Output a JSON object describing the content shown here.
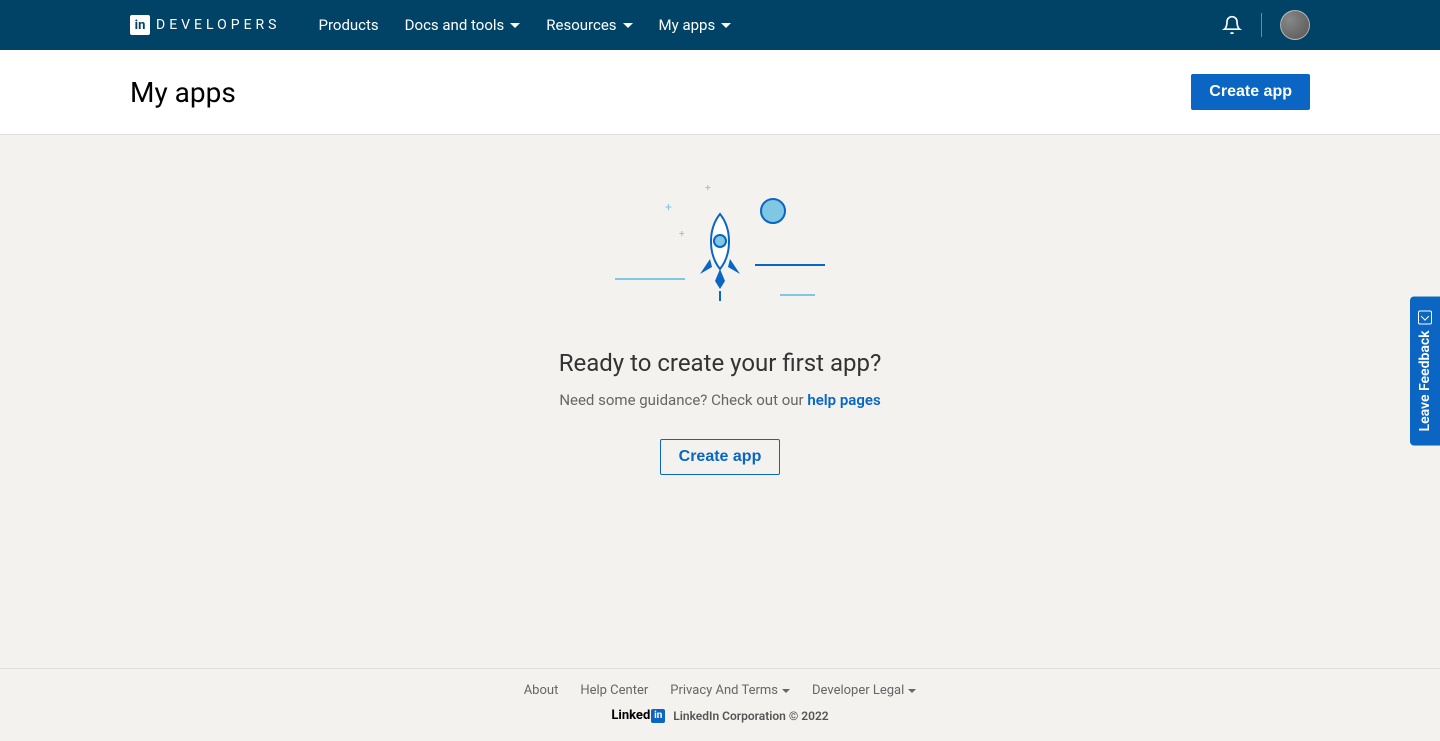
{
  "header": {
    "logo_text": "DEVELOPERS",
    "nav": [
      {
        "label": "Products",
        "dropdown": false
      },
      {
        "label": "Docs and tools",
        "dropdown": true
      },
      {
        "label": "Resources",
        "dropdown": true
      },
      {
        "label": "My apps",
        "dropdown": true
      }
    ]
  },
  "subheader": {
    "title": "My apps",
    "create_label": "Create app"
  },
  "empty_state": {
    "headline": "Ready to create your first app?",
    "sub_prefix": "Need some guidance? Check out our ",
    "help_link": "help pages",
    "create_label": "Create app"
  },
  "feedback": {
    "label": "Leave Feedback"
  },
  "footer": {
    "links": [
      {
        "label": "About",
        "dropdown": false
      },
      {
        "label": "Help Center",
        "dropdown": false
      },
      {
        "label": "Privacy And Terms",
        "dropdown": true
      },
      {
        "label": "Developer Legal",
        "dropdown": true
      }
    ],
    "brand": "Linked",
    "copyright": "LinkedIn Corporation © 2022"
  }
}
